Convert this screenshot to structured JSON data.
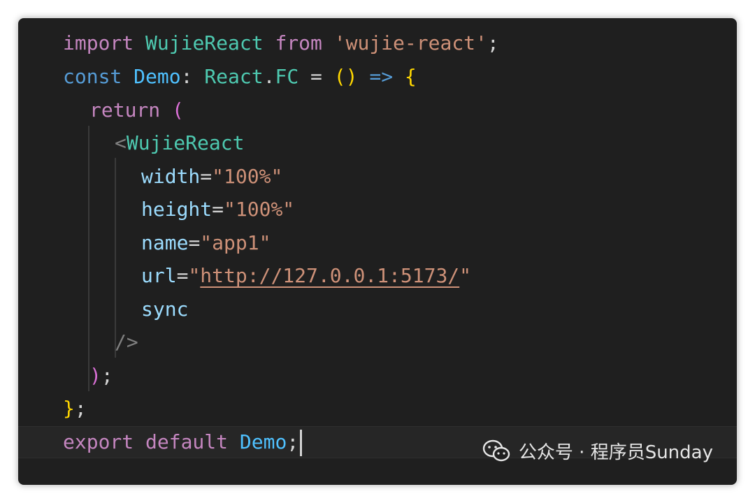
{
  "editor": {
    "lines": {
      "l1": {
        "kw": "import",
        "name": "WujieReact",
        "from": "from",
        "module": "'wujie-react'",
        "semi": ";"
      },
      "l2": {
        "const": "const",
        "name": "Demo",
        "colon": ":",
        "ns": "React",
        "dot": ".",
        "type": "FC",
        "eq": "=",
        "parens": "()",
        "arrow": "=>",
        "brace": "{"
      },
      "l3": {
        "ret": "return",
        "paren": "("
      },
      "l4": {
        "lt": "<",
        "tag": "WujieReact"
      },
      "l5": {
        "attr": "width",
        "eq": "=",
        "val": "\"100%\""
      },
      "l6": {
        "attr": "height",
        "eq": "=",
        "val": "\"100%\""
      },
      "l7": {
        "attr": "name",
        "eq": "=",
        "val": "\"app1\""
      },
      "l8": {
        "attr": "url",
        "eq": "=",
        "q1": "\"",
        "link": "http://127.0.0.1:5173/",
        "q2": "\""
      },
      "l9": {
        "attr": "sync"
      },
      "l10": {
        "close": "/>"
      },
      "l11": {
        "paren": ")",
        "semi": ";"
      },
      "l12": {
        "brace": "}",
        "semi": ";"
      },
      "l13": {
        "export": "export default",
        "name": "Demo",
        "semi": ";"
      }
    }
  },
  "watermark": {
    "icon": "wechat-icon",
    "text": "公众号 · 程序员Sunday"
  },
  "colors": {
    "background": "#1f1f1f",
    "keyword": "#c586c0",
    "declaration": "#569cd6",
    "type": "#4ec9b0",
    "string": "#ce9178",
    "attribute": "#9cdcfe"
  }
}
